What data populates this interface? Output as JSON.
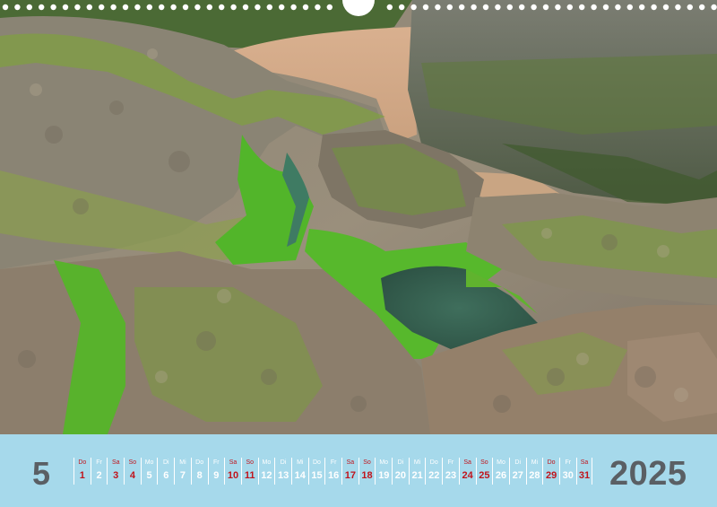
{
  "calendar": {
    "month_number": "5",
    "year": "2025",
    "days": [
      {
        "wd": "Do",
        "d": "1",
        "red": true
      },
      {
        "wd": "Fr",
        "d": "2",
        "red": false
      },
      {
        "wd": "Sa",
        "d": "3",
        "red": true
      },
      {
        "wd": "So",
        "d": "4",
        "red": true
      },
      {
        "wd": "Mo",
        "d": "5",
        "red": false
      },
      {
        "wd": "Di",
        "d": "6",
        "red": false
      },
      {
        "wd": "Mi",
        "d": "7",
        "red": false
      },
      {
        "wd": "Do",
        "d": "8",
        "red": false
      },
      {
        "wd": "Fr",
        "d": "9",
        "red": false
      },
      {
        "wd": "Sa",
        "d": "10",
        "red": true
      },
      {
        "wd": "So",
        "d": "11",
        "red": true
      },
      {
        "wd": "Mo",
        "d": "12",
        "red": false
      },
      {
        "wd": "Di",
        "d": "13",
        "red": false
      },
      {
        "wd": "Mi",
        "d": "14",
        "red": false
      },
      {
        "wd": "Do",
        "d": "15",
        "red": false
      },
      {
        "wd": "Fr",
        "d": "16",
        "red": false
      },
      {
        "wd": "Sa",
        "d": "17",
        "red": true
      },
      {
        "wd": "So",
        "d": "18",
        "red": true
      },
      {
        "wd": "Mo",
        "d": "19",
        "red": false
      },
      {
        "wd": "Di",
        "d": "20",
        "red": false
      },
      {
        "wd": "Mi",
        "d": "21",
        "red": false
      },
      {
        "wd": "Do",
        "d": "22",
        "red": false
      },
      {
        "wd": "Fr",
        "d": "23",
        "red": false
      },
      {
        "wd": "Sa",
        "d": "24",
        "red": true
      },
      {
        "wd": "So",
        "d": "25",
        "red": true
      },
      {
        "wd": "Mo",
        "d": "26",
        "red": false
      },
      {
        "wd": "Di",
        "d": "27",
        "red": false
      },
      {
        "wd": "Mi",
        "d": "28",
        "red": false
      },
      {
        "wd": "Do",
        "d": "29",
        "red": true
      },
      {
        "wd": "Fr",
        "d": "30",
        "red": false
      },
      {
        "wd": "Sa",
        "d": "31",
        "red": true
      }
    ]
  },
  "colors": {
    "strip": "#a6d9eb",
    "number_text": "#5a5f64",
    "holiday_red": "#c0141c",
    "weekday_text": "#ffffff"
  }
}
